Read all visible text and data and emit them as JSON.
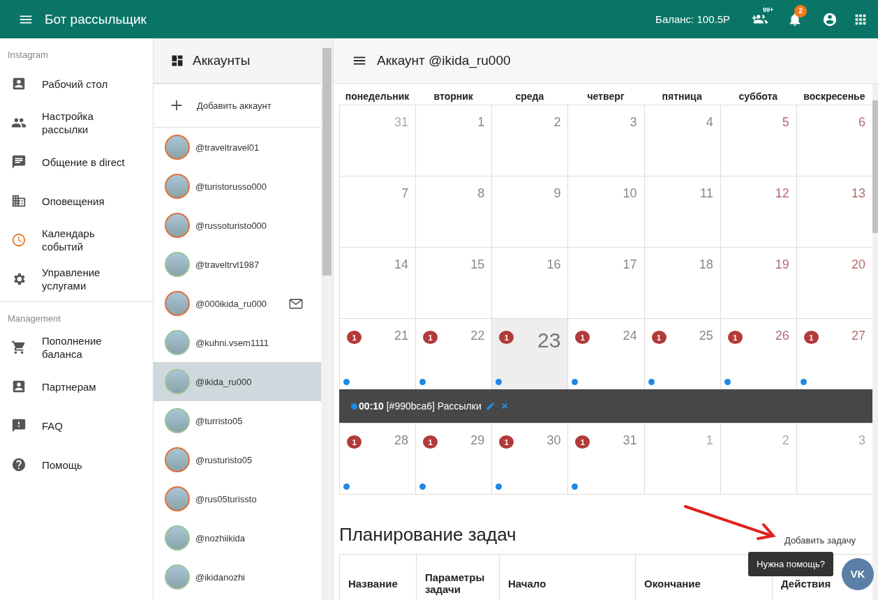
{
  "app_bar": {
    "title": "Бот рассыльщик",
    "balance": "Баланс: 100.5Р",
    "followers_badge": "99+",
    "notifications_badge": "2"
  },
  "sidebar": {
    "sections": [
      {
        "title": "Instagram",
        "items": [
          {
            "label": "Рабочий стол",
            "kind": "dashboard",
            "selected": false
          },
          {
            "label": "Настройка рассылки",
            "kind": "people",
            "selected": false
          },
          {
            "label": "Общение в direct",
            "kind": "chat",
            "selected": false
          },
          {
            "label": "Оповещения",
            "kind": "building",
            "selected": false
          },
          {
            "label": "Календарь событий",
            "kind": "clock",
            "selected": true
          },
          {
            "label": "Управление услугами",
            "kind": "gear",
            "selected": false
          }
        ]
      },
      {
        "title": "Management",
        "items": [
          {
            "label": "Пополнение баланса",
            "kind": "cart",
            "selected": false
          },
          {
            "label": "Партнерам",
            "kind": "contact",
            "selected": false
          },
          {
            "label": "FAQ",
            "kind": "alert",
            "selected": false
          },
          {
            "label": "Помощь",
            "kind": "help",
            "selected": false
          }
        ]
      }
    ]
  },
  "accounts": {
    "title": "Аккаунты",
    "add_label": "Добавить аккаунт",
    "items": [
      {
        "handle": "@traveltravel01",
        "color": "#e0703c",
        "selected": false,
        "message": false
      },
      {
        "handle": "@turistorusso000",
        "color": "#e0703c",
        "selected": false,
        "message": false
      },
      {
        "handle": "@russoturisto000",
        "color": "#e0703c",
        "selected": false,
        "message": false
      },
      {
        "handle": "@traveltrvl1987",
        "color": "#9cc49a",
        "selected": false,
        "message": false
      },
      {
        "handle": "@000ikida_ru000",
        "color": "#e0703c",
        "selected": false,
        "message": true
      },
      {
        "handle": "@kuhni.vsem1111",
        "color": "#9cc49a",
        "selected": false,
        "message": false
      },
      {
        "handle": "@ikida_ru000",
        "color": "#9cc49a",
        "selected": true,
        "message": false
      },
      {
        "handle": "@turristo05",
        "color": "#9cc49a",
        "selected": false,
        "message": false
      },
      {
        "handle": "@rusturisto05",
        "color": "#e0703c",
        "selected": false,
        "message": false
      },
      {
        "handle": "@rus05turissto",
        "color": "#e0703c",
        "selected": false,
        "message": false
      },
      {
        "handle": "@nozhiikida",
        "color": "#9cc49a",
        "selected": false,
        "message": false
      },
      {
        "handle": "@ikidanozhi",
        "color": "#9cc49a",
        "selected": false,
        "message": false
      }
    ]
  },
  "main": {
    "title": "Аккаунт @ikida_ru000",
    "calendar": {
      "weekdays": [
        "понедельник",
        "вторник",
        "среда",
        "четверг",
        "пятница",
        "суббота",
        "воскресенье"
      ],
      "weeks": [
        {
          "days": [
            {
              "label": "31",
              "kind": "other",
              "dot": false
            },
            {
              "label": "1",
              "kind": "weekday",
              "dot": false
            },
            {
              "label": "2",
              "kind": "weekday",
              "dot": false
            },
            {
              "label": "3",
              "kind": "weekday",
              "dot": false
            },
            {
              "label": "4",
              "kind": "weekday",
              "dot": false
            },
            {
              "label": "5",
              "kind": "weekend",
              "dot": false
            },
            {
              "label": "6",
              "kind": "weekend",
              "dot": false
            }
          ]
        },
        {
          "days": [
            {
              "label": "7",
              "kind": "weekday",
              "dot": false
            },
            {
              "label": "8",
              "kind": "weekday",
              "dot": false
            },
            {
              "label": "9",
              "kind": "weekday",
              "dot": false
            },
            {
              "label": "10",
              "kind": "weekday",
              "dot": false
            },
            {
              "label": "11",
              "kind": "weekday",
              "dot": false
            },
            {
              "label": "12",
              "kind": "weekend",
              "dot": false
            },
            {
              "label": "13",
              "kind": "weekend",
              "dot": false
            }
          ]
        },
        {
          "days": [
            {
              "label": "14",
              "kind": "weekday",
              "dot": false
            },
            {
              "label": "15",
              "kind": "weekday",
              "dot": false
            },
            {
              "label": "16",
              "kind": "weekday",
              "dot": false
            },
            {
              "label": "17",
              "kind": "weekday",
              "dot": false
            },
            {
              "label": "18",
              "kind": "weekday",
              "dot": false
            },
            {
              "label": "19",
              "kind": "weekend",
              "dot": false
            },
            {
              "label": "20",
              "kind": "weekend",
              "dot": false
            }
          ]
        },
        {
          "days": [
            {
              "label": "21",
              "kind": "weekday",
              "badge": "1",
              "dot": true
            },
            {
              "label": "22",
              "kind": "weekday",
              "badge": "1",
              "dot": true
            },
            {
              "label": "23",
              "kind": "today",
              "badge": "1",
              "dot": true
            },
            {
              "label": "24",
              "kind": "weekday",
              "badge": "1",
              "dot": true
            },
            {
              "label": "25",
              "kind": "weekday",
              "badge": "1",
              "dot": true
            },
            {
              "label": "26",
              "kind": "weekend",
              "badge": "1",
              "dot": true
            },
            {
              "label": "27",
              "kind": "weekend",
              "badge": "1",
              "dot": true
            }
          ],
          "event": {
            "text": "**00:10** [#990bca6] Рассылки"
          }
        },
        {
          "days": [
            {
              "label": "28",
              "kind": "weekday",
              "badge": "1",
              "dot": true
            },
            {
              "label": "29",
              "kind": "weekday",
              "badge": "1",
              "dot": true
            },
            {
              "label": "30",
              "kind": "weekday",
              "badge": "1",
              "dot": true
            },
            {
              "label": "31",
              "kind": "weekday",
              "badge": "1",
              "dot": true
            },
            {
              "label": "1",
              "kind": "other",
              "dot": false
            },
            {
              "label": "2",
              "kind": "other",
              "dot": false
            },
            {
              "label": "3",
              "kind": "other",
              "dot": false
            }
          ]
        }
      ]
    },
    "tasks": {
      "title": "Планирование задач",
      "add_label": "Добавить задачу",
      "columns": [
        "Название",
        "Параметры задачи",
        "Начало",
        "Окончание",
        "Действия"
      ]
    }
  },
  "help": {
    "tooltip": "Нужна помощь?",
    "button": "VK"
  }
}
